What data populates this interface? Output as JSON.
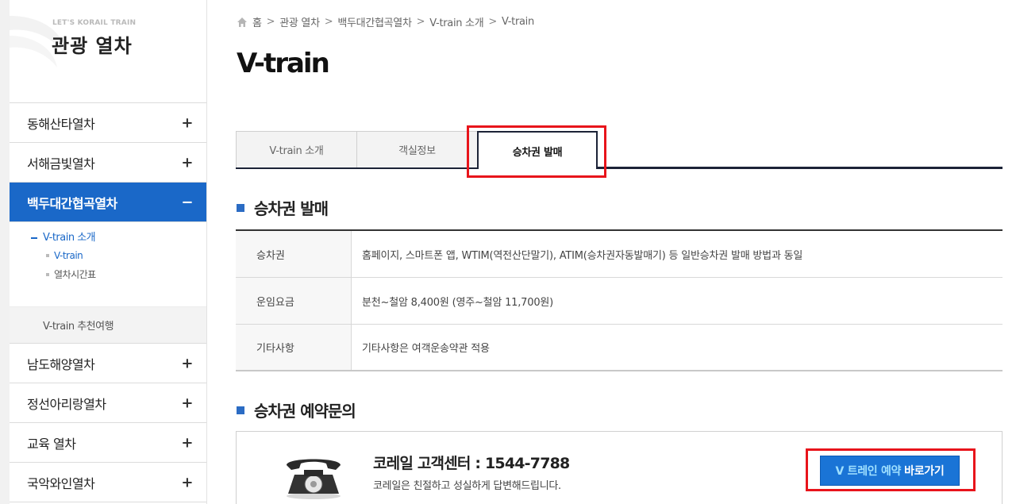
{
  "brand": {
    "subtitle": "LET'S KORAIL TRAIN",
    "title": "관광 열차"
  },
  "sidebar": {
    "items": [
      {
        "label": "동해산타열차",
        "toggle": "+"
      },
      {
        "label": "서해금빛열차",
        "toggle": "+"
      },
      {
        "label": "백두대간협곡열차",
        "toggle": "−"
      },
      {
        "label": "남도해양열차",
        "toggle": "+"
      },
      {
        "label": "정선아리랑열차",
        "toggle": "+"
      },
      {
        "label": "교육 열차",
        "toggle": "+"
      },
      {
        "label": "국악와인열차",
        "toggle": "+"
      }
    ],
    "submenu": {
      "group_label": "V-train 소개",
      "children": [
        "V-train",
        "열차시간표"
      ]
    },
    "recommend": "V-train 추천여행"
  },
  "breadcrumb": [
    "홈",
    "관광 열차",
    "백두대간협곡열차",
    "V-train 소개",
    "V-train"
  ],
  "breadcrumb_sep": ">",
  "page_title": "V-train",
  "tabs": [
    "V-train 소개",
    "객실정보",
    "승차권 발매"
  ],
  "active_tab": "승차권 발매",
  "section1": {
    "title": "승차권 발매",
    "rows": [
      {
        "label": "승차권",
        "value": "홈페이지, 스마트폰 앱, WTIM(역전산단말기), ATIM(승차권자동발매기) 등 일반승차권 발매 방법과 동일"
      },
      {
        "label": "운임요금",
        "value": "분천~철암 8,400원 (영주~철암 11,700원)"
      },
      {
        "label": "기타사항",
        "value": "기타사항은 여객운송약관 적용"
      }
    ]
  },
  "section2": {
    "title": "승차권 예약문의",
    "contact_title": "코레일 고객센터 : 1544-7788",
    "contact_desc": "코레일은 친절하고 성실하게 답변해드립니다.",
    "button_accent": "V 트레인 예약",
    "button_label": "바로가기"
  },
  "colors": {
    "accent_blue": "#1a68c8",
    "highlight_red": "#e8141b",
    "tab_border": "#1c2337"
  }
}
